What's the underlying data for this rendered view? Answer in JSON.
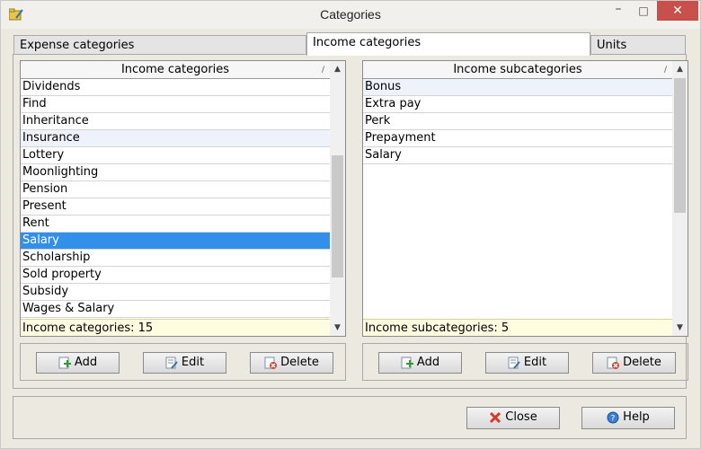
{
  "window": {
    "title": "Categories",
    "app_icon": "folder-pencil-icon",
    "controls": {
      "minimize": "–",
      "maximize": "□",
      "close": "✕"
    }
  },
  "tabs": [
    {
      "label": "Expense categories",
      "active": false
    },
    {
      "label": "Income categories",
      "active": true
    },
    {
      "label": "Units",
      "active": false
    }
  ],
  "left_list": {
    "header": "Income categories",
    "items": [
      "Dividends",
      "Find",
      "Inheritance",
      "Insurance",
      "Lottery",
      "Moonlighting",
      "Pension",
      "Present",
      "Rent",
      "Salary",
      "Scholarship",
      "Sold property",
      "Subsidy",
      "Wages & Salary"
    ],
    "selected": "Salary",
    "footer": "Income categories: 15"
  },
  "right_list": {
    "header": "Income subcategories",
    "items": [
      "Bonus",
      "Extra pay",
      "Perk",
      "Prepayment",
      "Salary"
    ],
    "selected": "Bonus",
    "footer": "Income subcategories: 5"
  },
  "left_buttons": {
    "add": "Add",
    "edit": "Edit",
    "delete": "Delete"
  },
  "right_buttons": {
    "add": "Add",
    "edit": "Edit",
    "delete": "Delete"
  },
  "dialog_buttons": {
    "close": "Close",
    "help": "Help"
  },
  "colors": {
    "selection": "#3290eb",
    "footer_bg": "#fffde0",
    "close_button": "#c7504a"
  }
}
